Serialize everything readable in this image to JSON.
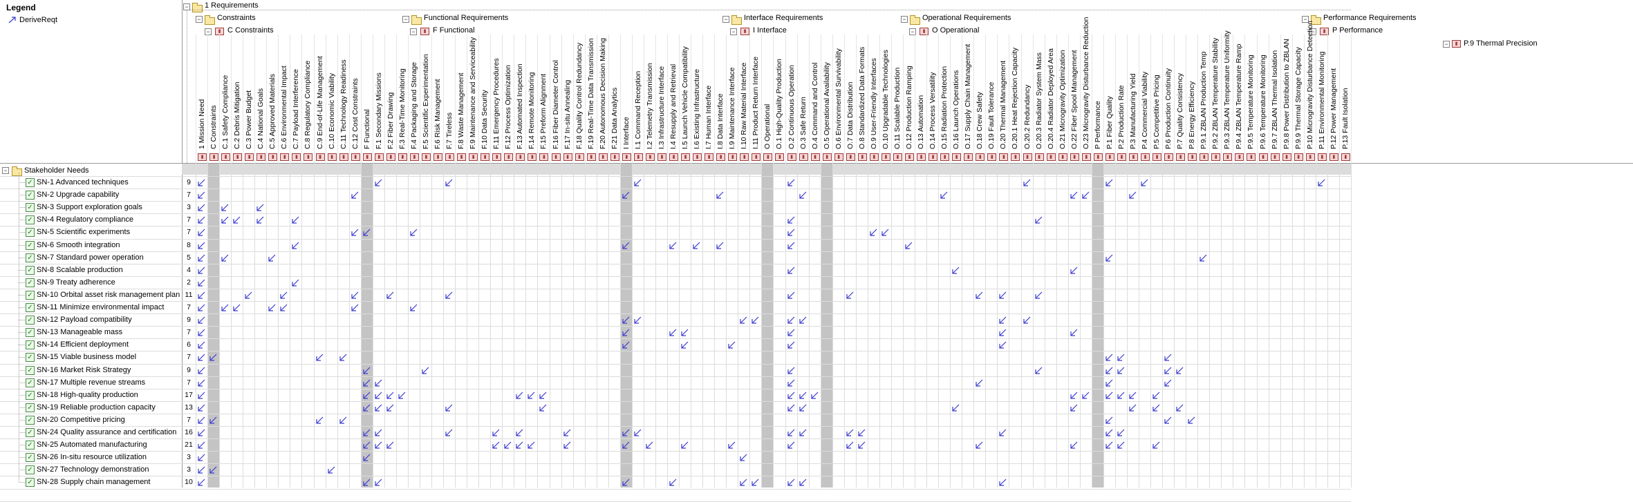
{
  "legend": {
    "title": "Legend",
    "item_label": "DeriveReqt"
  },
  "tree": {
    "root": "1 Requirements",
    "groups": [
      {
        "label": "Constraints",
        "sub": "C Constraints"
      },
      {
        "label": "Functional Requirements",
        "sub": "F Functional"
      },
      {
        "label": "Interface Requirements",
        "sub": "I Interface"
      },
      {
        "label": "Operational Requirements",
        "sub": "O Operational"
      },
      {
        "label": "Performance Requirements",
        "sub": "P Performance"
      }
    ],
    "sub_sub": "P.9 Thermal Precision"
  },
  "columns": [
    {
      "label": "1 Mission Need",
      "count": "25",
      "grey": false
    },
    {
      "label": "C Constraints",
      "count": "8",
      "grey": true
    },
    {
      "label": "C.1 Safety Compliance",
      "count": "1"
    },
    {
      "label": "C.2 Debris Mitigation",
      "count": "2"
    },
    {
      "label": "C.3 Power Budget",
      "count": "1"
    },
    {
      "label": "C.4 National Goals",
      "count": "1"
    },
    {
      "label": "C.5 Approved Materials",
      "count": "1"
    },
    {
      "label": "C.6 Environmental Impact",
      "count": "2"
    },
    {
      "label": "C.7 Payload Interference",
      "count": "1"
    },
    {
      "label": "C.8 Regulatory Compliance",
      "count": "2"
    },
    {
      "label": "C.9 End-of-Life Management",
      "count": "1"
    },
    {
      "label": "C.10 Economic Viability",
      "count": "2"
    },
    {
      "label": "C.11 Technology Readiness",
      "count": "1"
    },
    {
      "label": "C.12 Cost Constraints",
      "count": "1"
    },
    {
      "label": "F Functional",
      "count": "12",
      "grey": true
    },
    {
      "label": "F.1 Secondary Missions",
      "count": "2"
    },
    {
      "label": "F.2 Fiber Drawing",
      "count": "2"
    },
    {
      "label": "F.3 Real-Time Monitoring",
      "count": "3"
    },
    {
      "label": "F.4 Packaging and Storage",
      "count": "1"
    },
    {
      "label": "F.5 Scientific Experimentation",
      "count": "1"
    },
    {
      "label": "F.6 Risk Management",
      "count": "2"
    },
    {
      "label": "F.7 Tireless",
      "count": "1"
    },
    {
      "label": "F.8 Waste Management",
      "count": "1"
    },
    {
      "label": "F.9 Maintenance and Serviceability",
      "count": "1"
    },
    {
      "label": "F.10 Data Security",
      "count": "2"
    },
    {
      "label": "F.11 Emergency Procedures",
      "count": "1"
    },
    {
      "label": "F.12 Process Optimization",
      "count": "3"
    },
    {
      "label": "F.13 Automated Inspection",
      "count": "2"
    },
    {
      "label": "F.14 Remote Monitoring",
      "count": "1"
    },
    {
      "label": "F.15 Preform Alignment",
      "count": "1"
    },
    {
      "label": "F.16 Fiber Diameter Control",
      "count": "2"
    },
    {
      "label": "F.17 In-situ Annealing",
      "count": "2"
    },
    {
      "label": "F.18 Quality Control Redundancy",
      "count": ""
    },
    {
      "label": "F.19 Real-Time Data Transmission",
      "count": ""
    },
    {
      "label": "F.20 Autonomous Decision Making",
      "count": ""
    },
    {
      "label": "F.21 Data Analytics",
      "count": ""
    },
    {
      "label": "I Interface",
      "count": "8",
      "grey": true
    },
    {
      "label": "I.1 Command Reception",
      "count": "1"
    },
    {
      "label": "I.2 Telemetry Transmission",
      "count": "2"
    },
    {
      "label": "I.3 Infrastructure Interface",
      "count": "1"
    },
    {
      "label": "I.4 Resupply and Retrieval",
      "count": "3"
    },
    {
      "label": "I.5 Launch Vehicle Compatibility",
      "count": "3"
    },
    {
      "label": "I.6 Existing Infrastructure",
      "count": "2"
    },
    {
      "label": "I.7 Human Interface",
      "count": "1"
    },
    {
      "label": "I.8 Data Interface",
      "count": "1"
    },
    {
      "label": "I.9 Maintenance Interface",
      "count": "1"
    },
    {
      "label": "I.10 Raw Material Interface",
      "count": "4"
    },
    {
      "label": "I.11 Product Return Interface",
      "count": "2"
    },
    {
      "label": "O Operational",
      "count": "17",
      "grey": true
    },
    {
      "label": "O.1 High-Quality Production",
      "count": "2"
    },
    {
      "label": "O.2 Continuous Operation",
      "count": "2"
    },
    {
      "label": "O.3 Safe Return",
      "count": "3"
    },
    {
      "label": "O.4 Command and Control",
      "count": "1"
    },
    {
      "label": "O.5 Operational Availability",
      "count": "",
      "grey": true
    },
    {
      "label": "O.6 Environmental Survivability",
      "count": "3"
    },
    {
      "label": "O.7 Data Distribution",
      "count": "2"
    },
    {
      "label": "O.8 Standardized Data Formats",
      "count": "2"
    },
    {
      "label": "O.9 User-Friendly Interfaces",
      "count": "1"
    },
    {
      "label": "O.10 Upgradable Technologies",
      "count": ""
    },
    {
      "label": "O.11 Scalable Production",
      "count": ""
    },
    {
      "label": "O.12 Production Ramping",
      "count": "1"
    },
    {
      "label": "O.13 Automation",
      "count": "2"
    },
    {
      "label": "O.14 Process Versatility",
      "count": "1"
    },
    {
      "label": "O.15 Radiation Protection",
      "count": "1"
    },
    {
      "label": "O.16 Launch Operations",
      "count": "3"
    },
    {
      "label": "O.17 Supply Chain Management",
      "count": "1"
    },
    {
      "label": "O.18 Crew Safety",
      "count": "2"
    },
    {
      "label": "O.19 Fault Tolerance",
      "count": "3"
    },
    {
      "label": "O.20 Thermal Management",
      "count": "1"
    },
    {
      "label": "O.20.1 Heat Rejection Capacity",
      "count": ""
    },
    {
      "label": "O.20.2 Redundancy",
      "count": ""
    },
    {
      "label": "O.20.3 Radiator System Mass",
      "count": ""
    },
    {
      "label": "O.20.4 Radiator Deployed Area",
      "count": ""
    },
    {
      "label": "O.21 Microgravity Optimization",
      "count": ""
    },
    {
      "label": "O.22 Fiber Spool Management",
      "count": "2"
    },
    {
      "label": "O.23 Microgravity Disturbance Reduction",
      "count": "3"
    },
    {
      "label": "P Performance",
      "count": "2",
      "grey": true
    },
    {
      "label": "P.1 Fiber Quality",
      "count": "9"
    },
    {
      "label": "P.2 Production Rate",
      "count": "1"
    },
    {
      "label": "P.3 Manufacturing Yield",
      "count": "1"
    },
    {
      "label": "P.4 Commercial Viability",
      "count": "2"
    },
    {
      "label": "P.5 Competitive Pricing",
      "count": "3"
    },
    {
      "label": "P.6 Production Continuity",
      "count": "3"
    },
    {
      "label": "P.7 Quality Consistency",
      "count": "2"
    },
    {
      "label": "P.8 Energy Efficiency",
      "count": "2"
    },
    {
      "label": "P.9.1 ZBLAN Production Temp",
      "count": "1"
    },
    {
      "label": "P.9.2 ZBLAN Temperature Stability",
      "count": "2"
    },
    {
      "label": "P.9.3 ZBLAN Temperature Uniformity",
      "count": ""
    },
    {
      "label": "P.9.4 ZBLAN Temperature Ramp",
      "count": ""
    },
    {
      "label": "P.9.5 Temperature Monitoring",
      "count": ""
    },
    {
      "label": "P.9.6 Temperature Monitoring",
      "count": ""
    },
    {
      "label": "P.9.7 ZBLAN Thermal Isolation",
      "count": ""
    },
    {
      "label": "P.9.8 Power Distribution to ZBLAN",
      "count": ""
    },
    {
      "label": "P.9.9 Thermal Storage Capacity",
      "count": ""
    },
    {
      "label": "P.10 Microgravity Disturbance Detection",
      "count": ""
    },
    {
      "label": "P.11 Environmental Monitoring",
      "count": ""
    },
    {
      "label": "P.12 Power Management",
      "count": ""
    },
    {
      "label": "P.13 Fault Isolation",
      "count": ""
    }
  ],
  "rows_root": "Stakeholder Needs",
  "rows": [
    {
      "label": "SN-1 Advanced techniques",
      "count": "9",
      "cells": [
        0,
        15,
        21,
        37,
        50,
        70,
        77,
        80,
        95
      ]
    },
    {
      "label": "SN-2 Upgrade capability",
      "count": "7",
      "cells": [
        0,
        13,
        36,
        44,
        51,
        63,
        74,
        75,
        79
      ]
    },
    {
      "label": "SN-3 Support exploration goals",
      "count": "3",
      "cells": [
        0,
        2,
        5
      ]
    },
    {
      "label": "SN-4 Regulatory compliance",
      "count": "7",
      "cells": [
        0,
        2,
        3,
        5,
        8,
        50,
        71
      ]
    },
    {
      "label": "SN-5 Scientific experiments",
      "count": "7",
      "cells": [
        0,
        13,
        14,
        18,
        50,
        57,
        58
      ]
    },
    {
      "label": "SN-6 Smooth integration",
      "count": "8",
      "cells": [
        0,
        8,
        36,
        40,
        42,
        44,
        50,
        60
      ]
    },
    {
      "label": "SN-7 Standard power operation",
      "count": "5",
      "cells": [
        0,
        2,
        6,
        77,
        85
      ]
    },
    {
      "label": "SN-8 Scalable production",
      "count": "4",
      "cells": [
        0,
        50,
        64,
        74
      ]
    },
    {
      "label": "SN-9 Treaty adherence",
      "count": "2",
      "cells": [
        0,
        8
      ]
    },
    {
      "label": "SN-10 Orbital asset risk management plan",
      "count": "11",
      "cells": [
        0,
        4,
        7,
        13,
        16,
        21,
        50,
        55,
        66,
        68,
        71
      ]
    },
    {
      "label": "SN-11 Minimize environmental impact",
      "count": "7",
      "cells": [
        0,
        2,
        3,
        6,
        7,
        13,
        18
      ]
    },
    {
      "label": "SN-12 Payload compatibility",
      "count": "9",
      "cells": [
        0,
        36,
        37,
        46,
        47,
        50,
        51,
        68,
        70
      ]
    },
    {
      "label": "SN-13 Manageable mass",
      "count": "7",
      "cells": [
        0,
        36,
        40,
        41,
        50,
        68,
        74
      ]
    },
    {
      "label": "SN-14 Efficient deployment",
      "count": "6",
      "cells": [
        0,
        36,
        41,
        45,
        50,
        68
      ]
    },
    {
      "label": "SN-15 Viable business model",
      "count": "7",
      "cells": [
        0,
        1,
        10,
        12,
        77,
        78,
        82
      ]
    },
    {
      "label": "SN-16 Market Risk Strategy",
      "count": "9",
      "cells": [
        0,
        14,
        19,
        50,
        71,
        77,
        78,
        82,
        83
      ]
    },
    {
      "label": "SN-17 Multiple revenue streams",
      "count": "7",
      "cells": [
        0,
        14,
        15,
        50,
        66,
        77,
        82
      ]
    },
    {
      "label": "SN-18 High-quality production",
      "count": "17",
      "cells": [
        0,
        14,
        15,
        16,
        17,
        27,
        28,
        29,
        50,
        51,
        52,
        74,
        75,
        77,
        78,
        79,
        81
      ]
    },
    {
      "label": "SN-19 Reliable production capacity",
      "count": "13",
      "cells": [
        0,
        14,
        15,
        16,
        21,
        29,
        50,
        51,
        64,
        74,
        79,
        81,
        83
      ]
    },
    {
      "label": "SN-20 Competitive pricing",
      "count": "7",
      "cells": [
        0,
        1,
        10,
        12,
        77,
        82,
        84
      ]
    },
    {
      "label": "SN-24 Quality assurance and certification",
      "count": "16",
      "cells": [
        0,
        14,
        15,
        21,
        25,
        27,
        31,
        36,
        37,
        50,
        51,
        55,
        56,
        68,
        77,
        78
      ]
    },
    {
      "label": "SN-25 Automated manufacturing",
      "count": "21",
      "cells": [
        0,
        14,
        15,
        16,
        25,
        26,
        27,
        28,
        31,
        36,
        38,
        41,
        45,
        50,
        55,
        56,
        66,
        74,
        77,
        78,
        81
      ]
    },
    {
      "label": "SN-26 In-situ resource utilization",
      "count": "3",
      "cells": [
        0,
        14,
        46
      ]
    },
    {
      "label": "SN-27 Technology demonstration",
      "count": "3",
      "cells": [
        0,
        1,
        11
      ]
    },
    {
      "label": "SN-28 Supply chain management",
      "count": "10",
      "cells": [
        0,
        14,
        15,
        36,
        40,
        46,
        47,
        50,
        51,
        68
      ]
    }
  ],
  "col_counts_top": [
    "25",
    "8",
    "1",
    "2",
    "1",
    "1",
    "1",
    "2",
    "1",
    "2",
    "1",
    "2",
    "1",
    "1"
  ],
  "colors": {
    "arrow": "#3a3ad0",
    "grid": "#d4d4d4",
    "header_bg": "#cfcfcf",
    "grey_col": "#c4c4c4"
  }
}
